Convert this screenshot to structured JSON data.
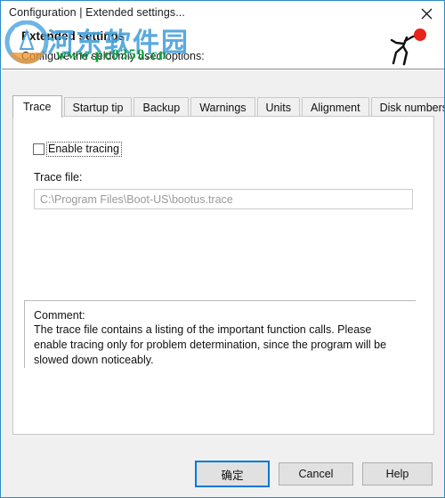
{
  "window": {
    "title": "Configuration | Extended settings...",
    "close_icon": "close-icon",
    "border_color": "#2e8ac4"
  },
  "header": {
    "title": "Extended settings",
    "subtitle": "Configure the seldomly used options:",
    "logo_icon": "running-figure-logo-icon"
  },
  "watermark": {
    "text": "河东软件园",
    "url": "www.pc0359.cn",
    "mark_icon": "site-badge-icon",
    "text_color": "#4aa3dd",
    "url_color": "#0e9c3e"
  },
  "tabs": [
    {
      "label": "Trace",
      "active": true
    },
    {
      "label": "Startup tip",
      "active": false
    },
    {
      "label": "Backup",
      "active": false
    },
    {
      "label": "Warnings",
      "active": false
    },
    {
      "label": "Units",
      "active": false
    },
    {
      "label": "Alignment",
      "active": false
    },
    {
      "label": "Disk numbers",
      "active": false
    }
  ],
  "trace_tab": {
    "enable_tracing_label": "Enable tracing",
    "enable_tracing_checked": false,
    "trace_file_label": "Trace file:",
    "trace_file_value": "C:\\Program Files\\Boot-US\\bootus.trace",
    "trace_file_placeholder": "C:\\Program Files\\Boot-US\\bootus.trace",
    "comment_title": "Comment:",
    "comment_body": "The trace file contains a listing of the important function calls. Please enable tracing only for problem determination, since the program will be slowed down noticeably."
  },
  "footer": {
    "ok_label": "确定",
    "cancel_label": "Cancel",
    "help_label": "Help",
    "focus_color": "#0078d7"
  }
}
